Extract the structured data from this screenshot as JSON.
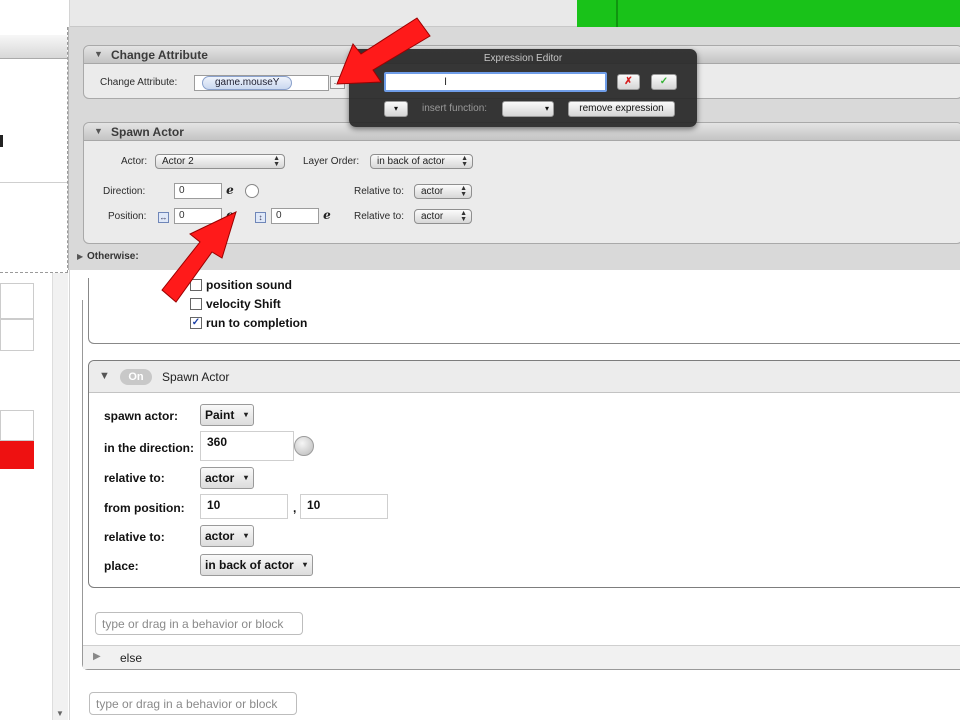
{
  "overlay": {
    "change_attribute": {
      "title": "Change Attribute",
      "label": "Change Attribute:",
      "token": "game.mouseY",
      "dots": "..."
    },
    "expression_editor": {
      "title": "Expression Editor",
      "insert_function_label": "insert function:",
      "cancel": "✗",
      "confirm": "✓",
      "remove_expression": "remove expression"
    },
    "spawn_actor": {
      "title": "Spawn Actor",
      "actor_label": "Actor:",
      "actor_value": "Actor 2",
      "layer_order_label": "Layer Order:",
      "layer_order_value": "in back of actor",
      "direction_label": "Direction:",
      "direction_value": "0",
      "relative_to_label_1": "Relative to:",
      "relative_to_value_1": "actor",
      "position_label": "Position:",
      "position_x": "0",
      "position_y": "0",
      "relative_to_label_2": "Relative to:",
      "relative_to_value_2": "actor",
      "e_glyph": "e"
    },
    "otherwise_label": "Otherwise:"
  },
  "options": {
    "position_sound": "position sound",
    "velocity_shift": "velocity Shift",
    "run_to_completion": "run to completion",
    "run_to_completion_checked": true,
    "checkmark": "✓"
  },
  "spawn_block": {
    "on_label": "On",
    "title": "Spawn Actor",
    "spawn_actor_label": "spawn actor:",
    "spawn_actor_value": "Paint",
    "direction_label": "in the direction:",
    "direction_value": "360",
    "relative_to_label_1": "relative to:",
    "relative_to_value_1": "actor",
    "from_position_label": "from position:",
    "from_position_x": "10",
    "from_position_sep": ",",
    "from_position_y": "10",
    "relative_to_label_2": "relative to:",
    "relative_to_value_2": "actor",
    "place_label": "place:",
    "place_value": "in back of actor"
  },
  "drop_inputs": {
    "inner_placeholder": "type or drag in a behavior or block",
    "outer_placeholder": "type or drag in a behavior or block"
  },
  "else_label": "else",
  "colors": {
    "arrow": "#ff1a1a",
    "green_area": "#19c219",
    "left_red_bar": "#ee1111"
  },
  "icons": {
    "caret": "▾",
    "expand": "▶",
    "collapse": "▼"
  }
}
